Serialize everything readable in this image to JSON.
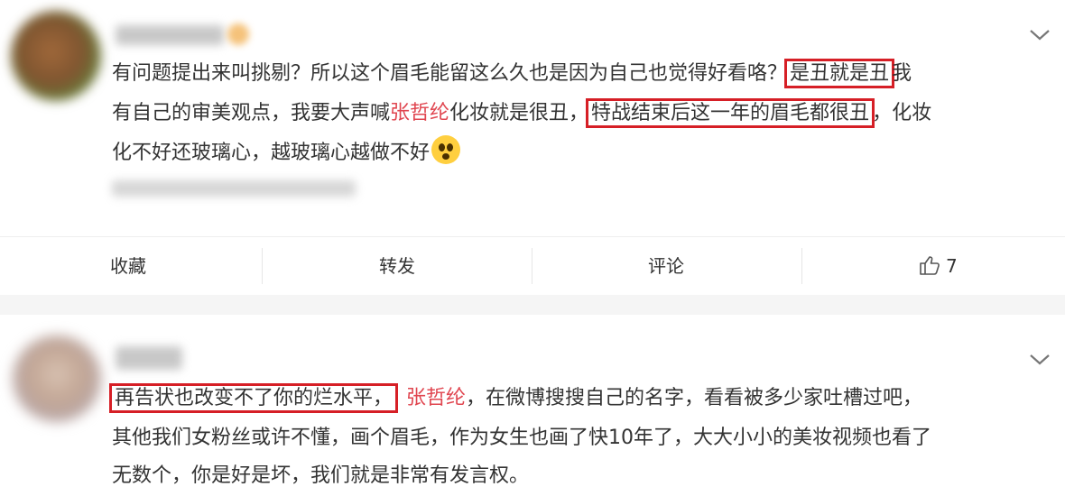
{
  "post1": {
    "text_line1_a": "有问题提出来叫挑剔？所以这个眉毛能留这么久也是因为自己也觉得好看咯？",
    "text_line1_box": "是丑就是丑",
    "text_line1_b": "我",
    "text_line2_a": "有自己的审美观点，我要大声喊",
    "text_line2_name": "张哲纶",
    "text_line2_b": "化妆就是很丑，",
    "text_line2_box": "特战结束后这一年的眉毛都很丑",
    "text_line2_c": "，化妆",
    "text_line3": "化不好还玻璃心，越玻璃心越做不好",
    "emoji_icon": "flushed-face-icon"
  },
  "actions": {
    "favorite": "收藏",
    "repost": "转发",
    "comment": "评论",
    "like_count": "7"
  },
  "post2": {
    "line1_box": "再告状也改变不了你的烂水平，",
    "line1_name": "张哲纶",
    "line1_rest": "，在微博搜搜自己的名字，看看被多少家吐槽过吧，",
    "line2": "其他我们女粉丝或许不懂，画个眉毛，作为女生也画了快10年了，大大小小的美妆视频也看了",
    "line3": "无数个，你是好是坏，我们就是非常有发言权。"
  },
  "colors": {
    "mention": "#e0454f",
    "highlight_box": "#d61f26",
    "text": "#333333"
  }
}
